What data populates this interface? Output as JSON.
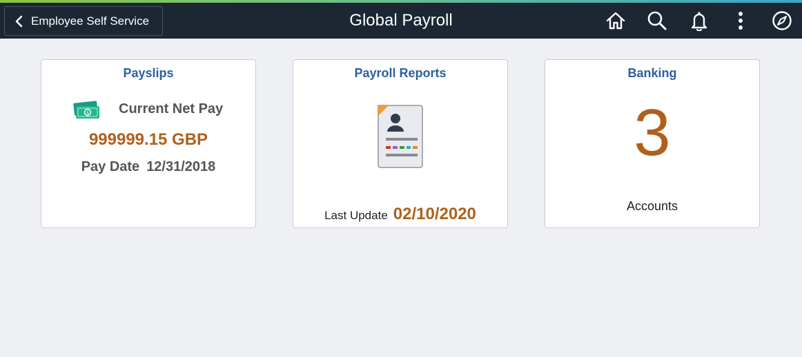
{
  "header": {
    "back_label": "Employee Self Service",
    "title": "Global Payroll",
    "icons": [
      "home-icon",
      "search-icon",
      "bell-icon",
      "more-vertical-icon",
      "compass-icon"
    ]
  },
  "colors": {
    "header_bg": "#1c2733",
    "tile_title": "#2d5f9e",
    "value_accent": "#b0601c",
    "page_bg": "#eef0f4"
  },
  "tiles": {
    "payslips": {
      "title": "Payslips",
      "net_pay_label": "Current Net Pay",
      "net_pay_amount": "999999.15 GBP",
      "pay_date_label": "Pay Date",
      "pay_date_value": "12/31/2018",
      "icon": "money-icon"
    },
    "payroll_reports": {
      "title": "Payroll Reports",
      "icon": "report-document-icon",
      "last_update_label": "Last Update",
      "last_update_value": "02/10/2020"
    },
    "banking": {
      "title": "Banking",
      "count": "3",
      "count_label": "Accounts"
    }
  }
}
